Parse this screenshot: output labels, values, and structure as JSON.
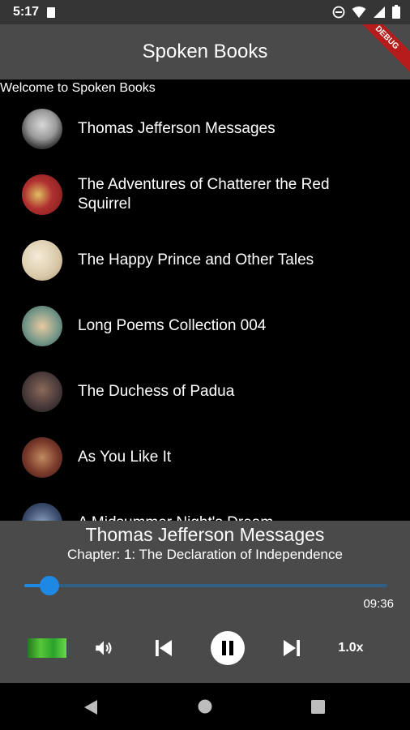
{
  "status": {
    "time": "5:17"
  },
  "appbar": {
    "title": "Spoken Books",
    "debug_label": "DEBUG"
  },
  "welcome": "Welcome to Spoken Books",
  "books": [
    {
      "title": "Thomas Jefferson Messages"
    },
    {
      "title": "The Adventures of Chatterer the Red Squirrel"
    },
    {
      "title": "The Happy Prince and Other Tales"
    },
    {
      "title": "Long Poems Collection 004"
    },
    {
      "title": "The Duchess of Padua"
    },
    {
      "title": "As You Like It"
    },
    {
      "title": "A Midsummer Night's Dream"
    }
  ],
  "player": {
    "title": "Thomas Jefferson Messages",
    "chapter": "Chapter: 1: The Declaration of Independence",
    "duration": "09:36",
    "progress": 0.07,
    "speed": "1.0x"
  },
  "colors": {
    "accent": "#1e88e5",
    "appbar": "#4a4a4a",
    "background": "#000000"
  }
}
